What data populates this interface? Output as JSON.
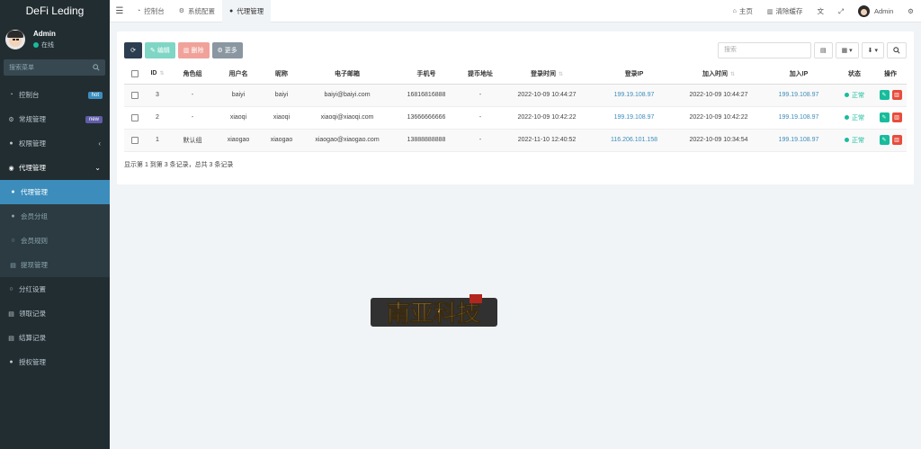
{
  "brand": "DeFi Leding",
  "user": {
    "name": "Admin",
    "status": "在线"
  },
  "sidebar": {
    "search_placeholder": "搜索菜单",
    "items": [
      {
        "label": "控制台",
        "icon": "dashboard-icon",
        "badge": "hot"
      },
      {
        "label": "常规管理",
        "icon": "cogs-icon",
        "badge": "new"
      },
      {
        "label": "权限管理",
        "icon": "group-icon",
        "caret": "‹"
      },
      {
        "label": "代理管理",
        "icon": "user-circle-icon",
        "caret": "⌄"
      },
      {
        "label": "代理管理",
        "icon": "user-icon",
        "sub": true,
        "active": true
      },
      {
        "label": "会员分组",
        "icon": "users-icon",
        "sub": true
      },
      {
        "label": "会员规则",
        "icon": "circle-icon",
        "sub": true
      },
      {
        "label": "提现管理",
        "icon": "list-icon",
        "sub": true
      },
      {
        "label": "分红设置",
        "icon": "settings-icon"
      },
      {
        "label": "领取记录",
        "icon": "list-icon"
      },
      {
        "label": "结算记录",
        "icon": "list-icon"
      },
      {
        "label": "授权管理",
        "icon": "users-icon"
      }
    ]
  },
  "topbar": {
    "tabs": [
      {
        "label": "控制台",
        "icon": "dashboard-icon"
      },
      {
        "label": "系统配置",
        "icon": "gear-icon"
      },
      {
        "label": "代理管理",
        "icon": "user-icon",
        "active": true
      }
    ],
    "home": "主页",
    "clear_cache": "清除缓存",
    "admin": "Admin"
  },
  "toolbar": {
    "edit": "编辑",
    "delete": "删除",
    "more": "更多",
    "search_placeholder": "搜索"
  },
  "table": {
    "headers": [
      "ID",
      "角色组",
      "用户名",
      "昵称",
      "电子邮箱",
      "手机号",
      "提币地址",
      "登录时间",
      "登录IP",
      "加入时间",
      "加入IP",
      "状态",
      "操作"
    ],
    "rows": [
      {
        "id": "3",
        "group": "-",
        "username": "baiyi",
        "nickname": "baiyi",
        "email": "baiyi@baiyi.com",
        "mobile": "16816816888",
        "address": "-",
        "login_time": "2022-10-09 10:44:27",
        "login_ip": "199.19.108.97",
        "join_time": "2022-10-09 10:44:27",
        "join_ip": "199.19.108.97",
        "status": "正常"
      },
      {
        "id": "2",
        "group": "-",
        "username": "xiaoqi",
        "nickname": "xiaoqi",
        "email": "xiaoqi@xiaoqi.com",
        "mobile": "13666666666",
        "address": "-",
        "login_time": "2022-10-09 10:42:22",
        "login_ip": "199.19.108.97",
        "join_time": "2022-10-09 10:42:22",
        "join_ip": "199.19.108.97",
        "status": "正常"
      },
      {
        "id": "1",
        "group": "默认组",
        "username": "xiaogao",
        "nickname": "xiaogao",
        "email": "xiaogao@xiaogao.com",
        "mobile": "13888888888",
        "address": "-",
        "login_time": "2022-11-10 12:40:52",
        "login_ip": "116.206.101.158",
        "join_time": "2022-10-09 10:34:54",
        "join_ip": "199.19.108.97",
        "status": "正常"
      }
    ],
    "pager": "显示第 1 到第 3 条记录，总共 3 条记录"
  },
  "logo_text": "南亚科技",
  "colors": {
    "sidebar": "#222d32",
    "active": "#3c8dbc",
    "success": "#18bc9c",
    "danger": "#e74c3c"
  }
}
